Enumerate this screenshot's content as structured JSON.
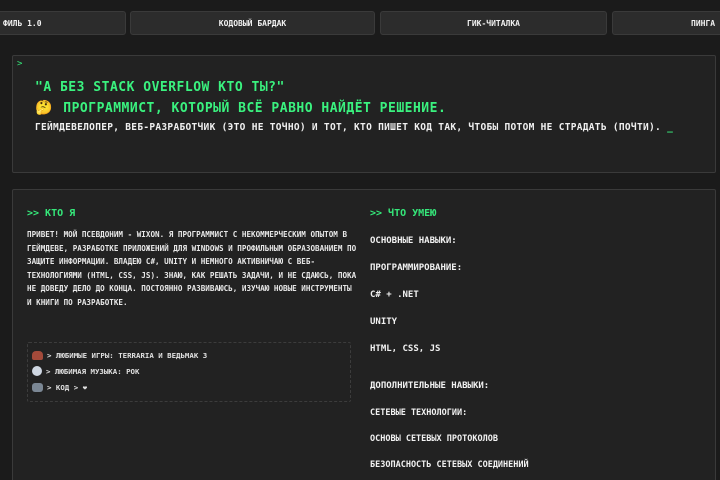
{
  "tabs": [
    {
      "label": "ФИЛЬ 1.0"
    },
    {
      "label": "КОДОВЫЙ БАРДАК"
    },
    {
      "label": "ГИК-ЧИТАЛКА"
    },
    {
      "label": "ПИНГА"
    }
  ],
  "hero": {
    "prompt": ">",
    "title_line1": "\"А БЕЗ STACK OVERFLOW КТО ТЫ?\"",
    "emoji": "🤔",
    "title_line2": "ПРОГРАММИСТ, КОТОРЫЙ ВСЁ РАВНО НАЙДЁТ РЕШЕНИЕ.",
    "description": "ГЕЙМДЕВЕЛОПЕР, ВЕБ-РАЗРАБОТЧИК (ЭТО НЕ ТОЧНО) И ТОТ, КТО ПИШЕТ КОД ТАК, ЧТОБЫ ПОТОМ НЕ СТРАДАТЬ (ПОЧТИ).",
    "cursor": "_"
  },
  "about": {
    "title": ">> КТО Я",
    "bio": "ПРИВЕТ! МОЙ ПСЕВДОНИМ - WIXON. Я ПРОГРАММИСТ С НЕКОММЕРЧЕСКИМ ОПЫТОМ В ГЕЙМДЕВЕ, РАЗРАБОТКЕ ПРИЛОЖЕНИЙ ДЛЯ WINDOWS И ПРОФИЛЬНЫМ ОБРАЗОВАНИЕМ ПО ЗАЩИТЕ ИНФОРМАЦИИ. ВЛАДЕЮ C#, UNITY И НЕМНОГО АКТИВНИЧАЮ С ВЕБ-ТЕХНОЛОГИЯМИ (HTML, CSS, JS). ЗНАЮ, КАК РЕШАТЬ ЗАДАЧИ, И НЕ СДАЮСЬ, ПОКА НЕ ДОВЕДУ ДЕЛО ДО КОНЦА. ПОСТОЯННО РАЗВИВАЮСЬ, ИЗУЧАЮ НОВЫЕ ИНСТРУМЕНТЫ И КНИГИ ПО РАЗРАБОТКЕ.",
    "favorites": [
      {
        "icon": "game-controller-icon",
        "text": "> ЛЮБИМЫЕ ИГРЫ: TERRARIA И ВЕДЬМАК 3"
      },
      {
        "icon": "music-icon",
        "text": "> ЛЮБИМАЯ МУЗЫКА: РОК"
      },
      {
        "icon": "code-icon",
        "text": "> КОД > ❤"
      }
    ]
  },
  "skills": {
    "title": ">> ЧТО УМЕЮ",
    "main_heading": "ОСНОВНЫЕ НАВЫКИ:",
    "programming_heading": "ПРОГРАММИРОВАНИЕ:",
    "programming": [
      "C# + .NET",
      "UNITY",
      "HTML, CSS, JS"
    ],
    "extra_heading": "ДОПОЛНИТЕЛЬНЫЕ НАВЫКИ:",
    "network_heading": "СЕТЕВЫЕ ТЕХНОЛОГИИ:",
    "network": [
      "ОСНОВЫ СЕТЕВЫХ ПРОТОКОЛОВ",
      "БЕЗОПАСНОСТЬ СЕТЕВЫХ СОЕДИНЕНИЙ"
    ]
  },
  "colors": {
    "background": "#1b1b1b",
    "panel": "#222222",
    "accent_green": "#3af27f",
    "text": "#f0f0f0"
  }
}
